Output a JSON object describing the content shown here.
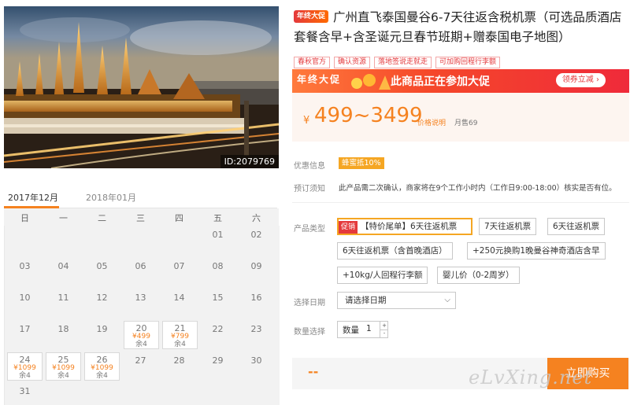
{
  "photo": {
    "id_label": "ID:2079769"
  },
  "calendar": {
    "months": [
      "2017年12月",
      "2018年01月"
    ],
    "weekdays": [
      "日",
      "一",
      "二",
      "三",
      "四",
      "五",
      "六"
    ],
    "days": {
      "d01": "01",
      "d02": "02",
      "d03": "03",
      "d04": "04",
      "d05": "05",
      "d06": "06",
      "d07": "07",
      "d08": "08",
      "d09": "09",
      "d10": "10",
      "d11": "11",
      "d12": "12",
      "d13": "13",
      "d14": "14",
      "d15": "15",
      "d16": "16",
      "d17": "17",
      "d18": "18",
      "d19": "19",
      "d20": "20",
      "d21": "21",
      "d22": "22",
      "d23": "23",
      "d24": "24",
      "d25": "25",
      "d26": "26",
      "d27": "27",
      "d28": "28",
      "d29": "29",
      "d30": "30",
      "d31": "31"
    },
    "priced": {
      "p20": {
        "price": "¥499",
        "stock": "余4"
      },
      "p21": {
        "price": "¥799",
        "stock": "余4"
      },
      "p24": {
        "price": "¥1099",
        "stock": "余4"
      },
      "p25": {
        "price": "¥1099",
        "stock": "余4"
      },
      "p26": {
        "price": "¥1099",
        "stock": "余4"
      }
    }
  },
  "product": {
    "badge": "年终大促",
    "title": "广州直飞泰国曼谷6-7天往返含税机票（可选品质酒店套餐含早+含圣诞元旦春节班期+赠泰国电子地图）",
    "tags": [
      "春秋官方",
      "确认资源",
      "落地签说走就走",
      "可加购回程行李额"
    ]
  },
  "promo": {
    "left": "年终大促",
    "main": "此商品正在参加大促",
    "coupon_btn": "领券立减 ›"
  },
  "price": {
    "symbol": "¥",
    "range": "499~3499",
    "note": "价格说明",
    "sold": "月售69"
  },
  "info": {
    "discount_label": "优惠信息",
    "discount_value": "蜂蜜抵10%",
    "notice_label": "预订须知",
    "notice_value": "此产品需二次确认，商家将在9个工作小时内（工作日9:00-18:00）核实是否有位。"
  },
  "options": {
    "label": "产品类型",
    "sale_tag": "促销",
    "items": [
      "【特价尾单】6天往返机票",
      "7天往返机票",
      "6天往返机票",
      "6天往返机票（含首晚酒店）",
      "+250元换购1晚曼谷神奇酒店含早",
      "+10kg/人回程行李额",
      "婴儿价（0-2周岁）"
    ]
  },
  "date_select": {
    "label": "选择日期",
    "value": "请选择日期"
  },
  "quantity": {
    "label": "数量选择",
    "field_label": "数量",
    "value": "1",
    "up": "+",
    "down": "-"
  },
  "bottom": {
    "placeholder": "--",
    "buy_label": "立即购买"
  },
  "watermark": "eLvXing.net"
}
